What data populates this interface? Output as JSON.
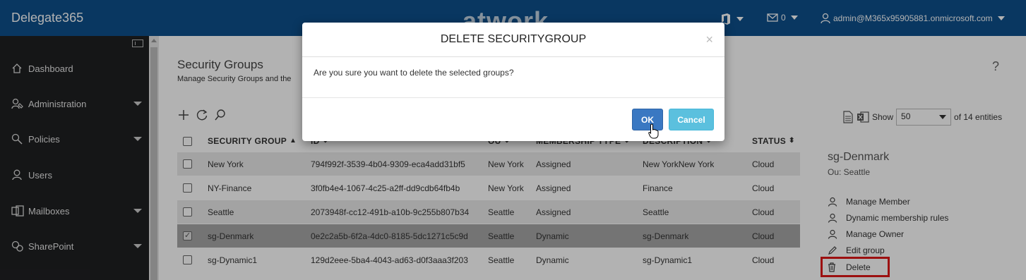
{
  "app": {
    "brand": "Delegate365",
    "watermark": "atwork",
    "mail_count": "0",
    "user": "admin@M365x95905881.onmicrosoft.com"
  },
  "sidebar": {
    "items": [
      {
        "label": "Dashboard",
        "icon": "home-icon"
      },
      {
        "label": "Administration",
        "icon": "admin-icon"
      },
      {
        "label": "Policies",
        "icon": "policies-icon"
      },
      {
        "label": "Users",
        "icon": "user-icon"
      },
      {
        "label": "Mailboxes",
        "icon": "mailbox-icon"
      },
      {
        "label": "SharePoint",
        "icon": "sharepoint-icon"
      }
    ]
  },
  "page": {
    "title": "Security Groups",
    "subtitle": "Manage Security Groups and the",
    "help": "?",
    "show_label": "Show",
    "page_size": "50",
    "entities_text": "of 14 entities"
  },
  "table": {
    "headers": [
      "SECURITY GROUP",
      "ID",
      "OU",
      "MEMBERSHIP TYPE",
      "DESCRIPTION",
      "STATUS"
    ],
    "rows": [
      {
        "name": "New York",
        "id": "794f992f-3539-4b04-9309-eca4add31bf5",
        "ou": "New York",
        "type": "Assigned",
        "description": "New YorkNew York",
        "status": "Cloud",
        "checked": false
      },
      {
        "name": "NY-Finance",
        "id": "3f0fb4e4-1067-4c25-a2ff-dd9cdb64fb4b",
        "ou": "New York",
        "type": "Assigned",
        "description": "Finance",
        "status": "Cloud",
        "checked": false
      },
      {
        "name": "Seattle",
        "id": "2073948f-cc12-491b-a10b-9c255b807b34",
        "ou": "Seattle",
        "type": "Assigned",
        "description": "Seattle",
        "status": "Cloud",
        "checked": false
      },
      {
        "name": "sg-Denmark",
        "id": "0e2c2a5b-6f2a-4dc0-8185-5dc1271c5c9d",
        "ou": "Seattle",
        "type": "Dynamic",
        "description": "sg-Denmark",
        "status": "Cloud",
        "checked": true
      },
      {
        "name": "sg-Dynamic1",
        "id": "129d2eee-5ba4-4043-ad63-d0f3aaa3f203",
        "ou": "Seattle",
        "type": "Dynamic",
        "description": "sg-Dynamic1",
        "status": "Cloud",
        "checked": false
      }
    ]
  },
  "detail": {
    "title": "sg-Denmark",
    "ou": "Ou: Seattle",
    "actions": [
      "Manage Member",
      "Dynamic membership rules",
      "Manage Owner",
      "Edit group",
      "Delete"
    ]
  },
  "modal": {
    "title": "DELETE SECURITYGROUP",
    "close": "×",
    "message": "Are you sure you want to delete the selected groups?",
    "ok": "OK",
    "cancel": "Cancel"
  },
  "colors": {
    "topbar": "#0d4f8b",
    "sidebar": "#1f2022",
    "ok_button": "#3a78c2",
    "cancel_button": "#5bc0de",
    "highlight": "#e01818"
  }
}
